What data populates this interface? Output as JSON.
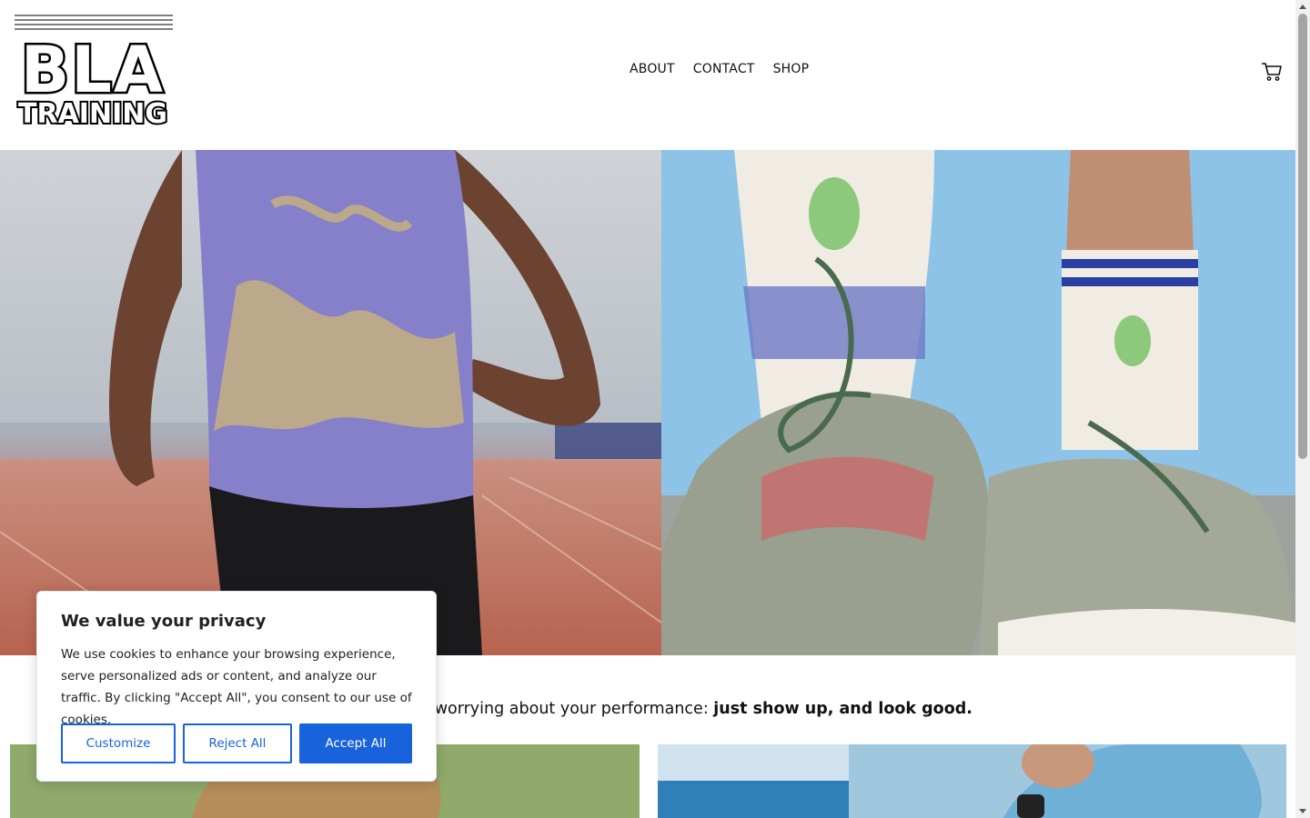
{
  "brand": {
    "logo_line1": "BLA",
    "logo_line2": "TRAINING"
  },
  "nav": {
    "items": [
      {
        "label": "ABOUT"
      },
      {
        "label": "CONTACT"
      },
      {
        "label": "SHOP"
      }
    ],
    "cart_icon": "cart-icon"
  },
  "tagline": {
    "text": "ly grind. Stop worrying about your performance: ",
    "bold": "just show up, and look good."
  },
  "cookie": {
    "title": "We value your privacy",
    "text": "We use cookies to enhance your browsing experience, serve personalized ads or content, and analyze our traffic. By clicking \"Accept All\", you consent to our use of cookies.",
    "customize_label": "Customize",
    "reject_label": "Reject All",
    "accept_label": "Accept All"
  },
  "colors": {
    "accent": "#1863dc",
    "text": "#111111",
    "background": "#ffffff"
  }
}
